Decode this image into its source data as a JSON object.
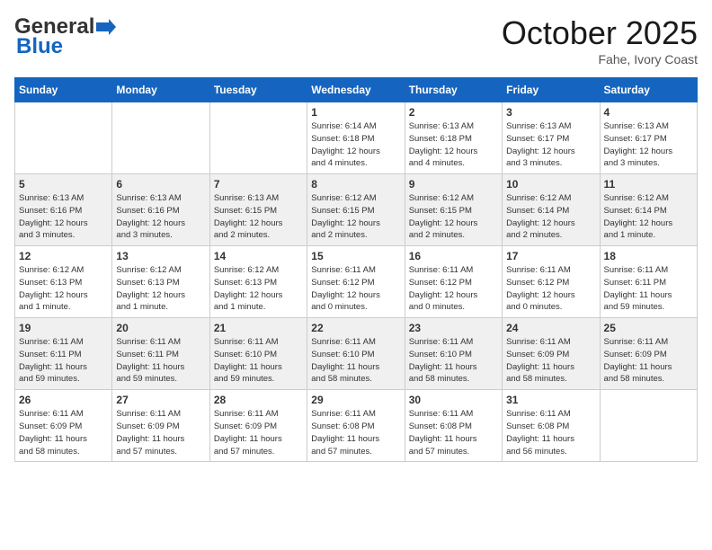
{
  "header": {
    "logo_general": "General",
    "logo_blue": "Blue",
    "month_title": "October 2025",
    "location": "Fahe, Ivory Coast"
  },
  "days_of_week": [
    "Sunday",
    "Monday",
    "Tuesday",
    "Wednesday",
    "Thursday",
    "Friday",
    "Saturday"
  ],
  "weeks": [
    [
      {
        "day": "",
        "info": ""
      },
      {
        "day": "",
        "info": ""
      },
      {
        "day": "",
        "info": ""
      },
      {
        "day": "1",
        "info": "Sunrise: 6:14 AM\nSunset: 6:18 PM\nDaylight: 12 hours\nand 4 minutes."
      },
      {
        "day": "2",
        "info": "Sunrise: 6:13 AM\nSunset: 6:18 PM\nDaylight: 12 hours\nand 4 minutes."
      },
      {
        "day": "3",
        "info": "Sunrise: 6:13 AM\nSunset: 6:17 PM\nDaylight: 12 hours\nand 3 minutes."
      },
      {
        "day": "4",
        "info": "Sunrise: 6:13 AM\nSunset: 6:17 PM\nDaylight: 12 hours\nand 3 minutes."
      }
    ],
    [
      {
        "day": "5",
        "info": "Sunrise: 6:13 AM\nSunset: 6:16 PM\nDaylight: 12 hours\nand 3 minutes."
      },
      {
        "day": "6",
        "info": "Sunrise: 6:13 AM\nSunset: 6:16 PM\nDaylight: 12 hours\nand 3 minutes."
      },
      {
        "day": "7",
        "info": "Sunrise: 6:13 AM\nSunset: 6:15 PM\nDaylight: 12 hours\nand 2 minutes."
      },
      {
        "day": "8",
        "info": "Sunrise: 6:12 AM\nSunset: 6:15 PM\nDaylight: 12 hours\nand 2 minutes."
      },
      {
        "day": "9",
        "info": "Sunrise: 6:12 AM\nSunset: 6:15 PM\nDaylight: 12 hours\nand 2 minutes."
      },
      {
        "day": "10",
        "info": "Sunrise: 6:12 AM\nSunset: 6:14 PM\nDaylight: 12 hours\nand 2 minutes."
      },
      {
        "day": "11",
        "info": "Sunrise: 6:12 AM\nSunset: 6:14 PM\nDaylight: 12 hours\nand 1 minute."
      }
    ],
    [
      {
        "day": "12",
        "info": "Sunrise: 6:12 AM\nSunset: 6:13 PM\nDaylight: 12 hours\nand 1 minute."
      },
      {
        "day": "13",
        "info": "Sunrise: 6:12 AM\nSunset: 6:13 PM\nDaylight: 12 hours\nand 1 minute."
      },
      {
        "day": "14",
        "info": "Sunrise: 6:12 AM\nSunset: 6:13 PM\nDaylight: 12 hours\nand 1 minute."
      },
      {
        "day": "15",
        "info": "Sunrise: 6:11 AM\nSunset: 6:12 PM\nDaylight: 12 hours\nand 0 minutes."
      },
      {
        "day": "16",
        "info": "Sunrise: 6:11 AM\nSunset: 6:12 PM\nDaylight: 12 hours\nand 0 minutes."
      },
      {
        "day": "17",
        "info": "Sunrise: 6:11 AM\nSunset: 6:12 PM\nDaylight: 12 hours\nand 0 minutes."
      },
      {
        "day": "18",
        "info": "Sunrise: 6:11 AM\nSunset: 6:11 PM\nDaylight: 11 hours\nand 59 minutes."
      }
    ],
    [
      {
        "day": "19",
        "info": "Sunrise: 6:11 AM\nSunset: 6:11 PM\nDaylight: 11 hours\nand 59 minutes."
      },
      {
        "day": "20",
        "info": "Sunrise: 6:11 AM\nSunset: 6:11 PM\nDaylight: 11 hours\nand 59 minutes."
      },
      {
        "day": "21",
        "info": "Sunrise: 6:11 AM\nSunset: 6:10 PM\nDaylight: 11 hours\nand 59 minutes."
      },
      {
        "day": "22",
        "info": "Sunrise: 6:11 AM\nSunset: 6:10 PM\nDaylight: 11 hours\nand 58 minutes."
      },
      {
        "day": "23",
        "info": "Sunrise: 6:11 AM\nSunset: 6:10 PM\nDaylight: 11 hours\nand 58 minutes."
      },
      {
        "day": "24",
        "info": "Sunrise: 6:11 AM\nSunset: 6:09 PM\nDaylight: 11 hours\nand 58 minutes."
      },
      {
        "day": "25",
        "info": "Sunrise: 6:11 AM\nSunset: 6:09 PM\nDaylight: 11 hours\nand 58 minutes."
      }
    ],
    [
      {
        "day": "26",
        "info": "Sunrise: 6:11 AM\nSunset: 6:09 PM\nDaylight: 11 hours\nand 58 minutes."
      },
      {
        "day": "27",
        "info": "Sunrise: 6:11 AM\nSunset: 6:09 PM\nDaylight: 11 hours\nand 57 minutes."
      },
      {
        "day": "28",
        "info": "Sunrise: 6:11 AM\nSunset: 6:09 PM\nDaylight: 11 hours\nand 57 minutes."
      },
      {
        "day": "29",
        "info": "Sunrise: 6:11 AM\nSunset: 6:08 PM\nDaylight: 11 hours\nand 57 minutes."
      },
      {
        "day": "30",
        "info": "Sunrise: 6:11 AM\nSunset: 6:08 PM\nDaylight: 11 hours\nand 57 minutes."
      },
      {
        "day": "31",
        "info": "Sunrise: 6:11 AM\nSunset: 6:08 PM\nDaylight: 11 hours\nand 56 minutes."
      },
      {
        "day": "",
        "info": ""
      }
    ]
  ]
}
